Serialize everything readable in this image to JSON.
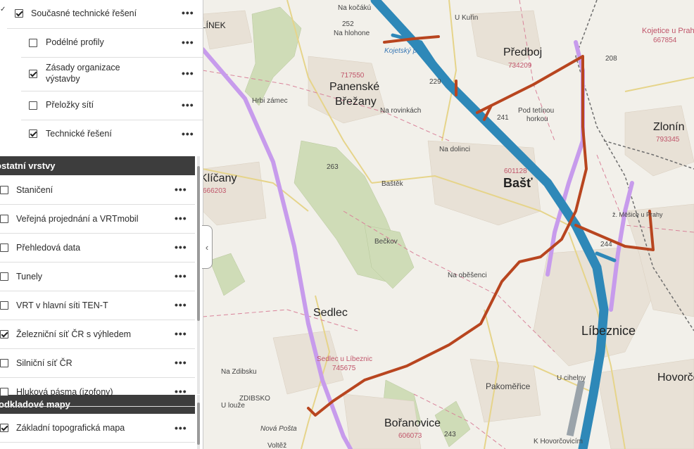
{
  "layers_top": {
    "current": {
      "label": "Současné technické řešení",
      "checked": true
    },
    "items": [
      {
        "label": "Podélné profily",
        "checked": false
      },
      {
        "label": "Zásady organizace výstavby",
        "checked": true
      },
      {
        "label": "Přeložky sítí",
        "checked": false
      },
      {
        "label": "Technické řešení",
        "checked": true
      }
    ]
  },
  "section_other": {
    "title": "ostatní vrstvy"
  },
  "other_items": [
    {
      "label": "Staničení",
      "checked": false
    },
    {
      "label": "Veřejná projednání a VRTmobil",
      "checked": false
    },
    {
      "label": "Přehledová data",
      "checked": false
    },
    {
      "label": "Tunely",
      "checked": false
    },
    {
      "label": "VRT v hlavní síti TEN-T",
      "checked": false
    },
    {
      "label": "Železniční síť ČR s výhledem",
      "checked": true
    },
    {
      "label": "Silniční síť ČR",
      "checked": false
    },
    {
      "label": "Hluková pásma (izofony)",
      "checked": false
    }
  ],
  "section_base": {
    "title": "odkladové mapy"
  },
  "base_items": [
    {
      "label": "Základní topografická mapa",
      "checked": true
    }
  ],
  "more_symbol": "•••",
  "collapse_symbol": "‹",
  "map_labels": {
    "predboj": "Předboj",
    "predboj_code": "734209",
    "panenske": "Panenské",
    "brezany": "Břežany",
    "panenske_code": "717550",
    "bast": "Bašť",
    "bast_code": "601128",
    "zlonin": "Zlonín",
    "zlonin_code": "793345",
    "sedlec": "Sedlec",
    "sedlec_libeznic": "Sedlec u Líbeznic",
    "sedlec_code": "745675",
    "libeznice": "Líbeznice",
    "pakomerice": "Pakoměřice",
    "boranovice": "Bořanovice",
    "boranovice_code": "606073",
    "hovorcovice": "Hovorčo",
    "klicany": "Klíčany",
    "klicany_code": "666203",
    "kojetice": "Kojetice u Prahy",
    "kojetice_code": "667854",
    "na_rovinkach": "Na rovinkách",
    "na_dolinci": "Na dolinci",
    "bastek": "Baštěk",
    "beckov": "Bečkov",
    "na_obecenci": "Na oběšenci",
    "pod_tetinou": "Pod tetínou",
    "horkou": "horkou",
    "nakocakem": "Na kočákú",
    "nahlohone": "Na hlohone",
    "na_zdibsku": "Na Zdibsku",
    "zdibsko": "ZDIBSKO",
    "u_louze": "U louže",
    "nova_posta": "Nová Pošta",
    "u_cihelny": "U cihelny",
    "k_hovorcovicim": "K Hovorčovicím",
    "kojetsky": "Kojetský p.",
    "klinek": "LÍNEK",
    "hrbi_zamec": "Hrbi zámec",
    "u_kucin": "U Kuřin",
    "meice": "ž. Měšice u Prahy",
    "voltaz": "Voltěž",
    "n208": "208",
    "n244": "244",
    "n241": "241",
    "n229": "229",
    "n252": "252",
    "n243": "243",
    "n263": "263"
  }
}
